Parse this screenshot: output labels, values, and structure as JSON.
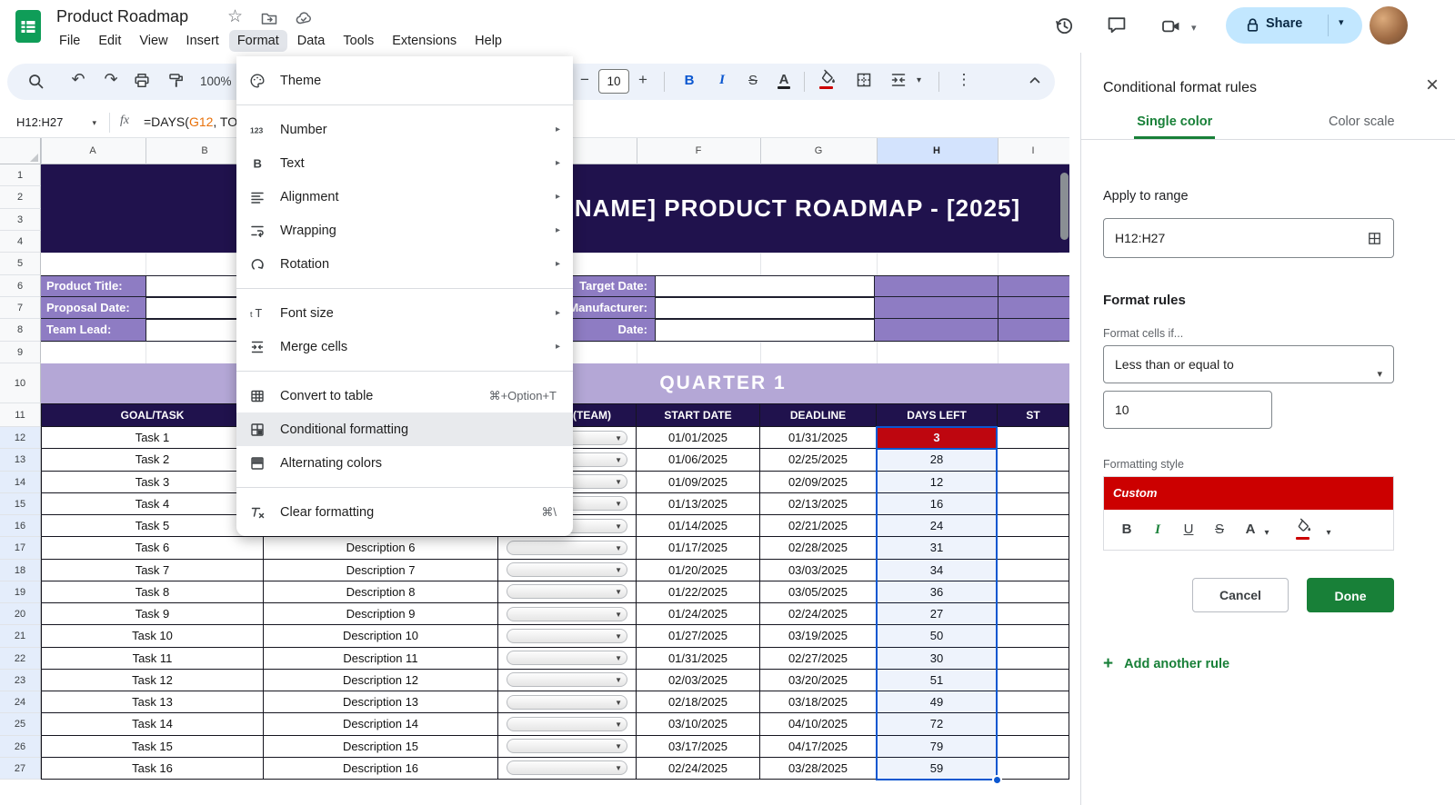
{
  "colors": {
    "accent_green": "#188038",
    "selection_blue": "#0b57d0",
    "rule_red": "#cc0000",
    "banner_purple": "#20124d",
    "info_purple": "#8e7cc3",
    "quarter_purple": "#b4a7d6",
    "share_blue": "#c2e7ff"
  },
  "titlebar": {
    "doc_title": "Product Roadmap",
    "menu_items": [
      "File",
      "Edit",
      "View",
      "Insert",
      "Format",
      "Data",
      "Tools",
      "Extensions",
      "Help"
    ],
    "active_menu": "Format",
    "share_label": "Share",
    "icons": [
      "sheets-logo",
      "star-icon",
      "move-folder-icon",
      "cloud-saved-icon",
      "history-icon",
      "comment-icon",
      "video-call-icon",
      "lock-icon",
      "avatar"
    ]
  },
  "toolbar": {
    "zoom": "100%",
    "font_size": "10",
    "icons": [
      "search-icon",
      "undo-icon",
      "redo-icon",
      "print-icon",
      "paint-format-icon",
      "font-decrease-icon",
      "font-increase-icon",
      "bold-icon",
      "italic-icon",
      "strikethrough-icon",
      "text-color-icon",
      "fill-color-icon",
      "borders-icon",
      "merge-cells-icon",
      "more-icon",
      "collapse-toolbar-icon"
    ]
  },
  "formula_bar": {
    "range": "H12:H27",
    "fx": "fx",
    "formula_prefix": "=DAYS(",
    "formula_ref": "G12",
    "formula_tail": ", TO"
  },
  "format_menu": {
    "items": [
      {
        "label": "Theme",
        "icon": "theme-palette-icon"
      },
      {
        "divider": true
      },
      {
        "label": "Number",
        "icon": "number-123-icon",
        "submenu": true
      },
      {
        "label": "Text",
        "icon": "text-bold-icon",
        "submenu": true
      },
      {
        "label": "Alignment",
        "icon": "alignment-icon",
        "submenu": true
      },
      {
        "label": "Wrapping",
        "icon": "wrapping-icon",
        "submenu": true
      },
      {
        "label": "Rotation",
        "icon": "rotation-icon",
        "submenu": true
      },
      {
        "divider": true
      },
      {
        "label": "Font size",
        "icon": "font-size-icon",
        "submenu": true
      },
      {
        "label": "Merge cells",
        "icon": "merge-cells-icon",
        "submenu": true
      },
      {
        "divider": true
      },
      {
        "label": "Convert to table",
        "icon": "table-icon",
        "shortcut": "⌘+Option+T"
      },
      {
        "label": "Conditional formatting",
        "icon": "conditional-format-icon",
        "highlighted": true
      },
      {
        "label": "Alternating colors",
        "icon": "alternating-colors-icon"
      },
      {
        "divider": true
      },
      {
        "label": "Clear formatting",
        "icon": "clear-format-icon",
        "shortcut": "⌘\\"
      }
    ]
  },
  "sheet": {
    "visible_col_letters": [
      "A",
      "B",
      "F",
      "G",
      "H",
      "I"
    ],
    "selected_col": "H",
    "row_count": 27,
    "selected_rows_start": 12,
    "title_banner": "NAME] PRODUCT ROADMAP - [2025]",
    "quarter_banner": "QUARTER 1",
    "info_rows": [
      {
        "left": "Product Title:",
        "right": "Target Date:"
      },
      {
        "left": "Proposal Date:",
        "right": "Manufacturer:"
      },
      {
        "left": "Team Lead:",
        "right": "Date:"
      }
    ],
    "table_headers": {
      "goal": "GOAL/TASK",
      "team": "(TEAM)",
      "start": "START DATE",
      "deadline": "DEADLINE",
      "days": "DAYS LEFT",
      "status": "ST"
    },
    "rows": [
      {
        "task": "Task 1",
        "desc": "",
        "start": "01/01/2025",
        "deadline": "01/31/2025",
        "days": "3",
        "red": true
      },
      {
        "task": "Task 2",
        "desc": "",
        "start": "01/06/2025",
        "deadline": "02/25/2025",
        "days": "28"
      },
      {
        "task": "Task 3",
        "desc": "",
        "start": "01/09/2025",
        "deadline": "02/09/2025",
        "days": "12"
      },
      {
        "task": "Task 4",
        "desc": "",
        "start": "01/13/2025",
        "deadline": "02/13/2025",
        "days": "16"
      },
      {
        "task": "Task 5",
        "desc": "",
        "start": "01/14/2025",
        "deadline": "02/21/2025",
        "days": "24"
      },
      {
        "task": "Task 6",
        "desc": "Description 6",
        "start": "01/17/2025",
        "deadline": "02/28/2025",
        "days": "31"
      },
      {
        "task": "Task 7",
        "desc": "Description 7",
        "start": "01/20/2025",
        "deadline": "03/03/2025",
        "days": "34"
      },
      {
        "task": "Task 8",
        "desc": "Description 8",
        "start": "01/22/2025",
        "deadline": "03/05/2025",
        "days": "36"
      },
      {
        "task": "Task 9",
        "desc": "Description 9",
        "start": "01/24/2025",
        "deadline": "02/24/2025",
        "days": "27"
      },
      {
        "task": "Task 10",
        "desc": "Description 10",
        "start": "01/27/2025",
        "deadline": "03/19/2025",
        "days": "50"
      },
      {
        "task": "Task 11",
        "desc": "Description 11",
        "start": "01/31/2025",
        "deadline": "02/27/2025",
        "days": "30"
      },
      {
        "task": "Task 12",
        "desc": "Description 12",
        "start": "02/03/2025",
        "deadline": "03/20/2025",
        "days": "51"
      },
      {
        "task": "Task 13",
        "desc": "Description 13",
        "start": "02/18/2025",
        "deadline": "03/18/2025",
        "days": "49"
      },
      {
        "task": "Task 14",
        "desc": "Description 14",
        "start": "03/10/2025",
        "deadline": "04/10/2025",
        "days": "72"
      },
      {
        "task": "Task 15",
        "desc": "Description 15",
        "start": "03/17/2025",
        "deadline": "04/17/2025",
        "days": "79"
      },
      {
        "task": "Task 16",
        "desc": "Description 16",
        "start": "02/24/2025",
        "deadline": "03/28/2025",
        "days": "59"
      }
    ]
  },
  "panel": {
    "title": "Conditional format rules",
    "tabs": [
      "Single color",
      "Color scale"
    ],
    "apply_label": "Apply to range",
    "range_value": "H12:H27",
    "format_rules_label": "Format rules",
    "cells_if_label": "Format cells if...",
    "condition": "Less than or equal to",
    "value": "10",
    "style_label": "Formatting style",
    "preview": "Custom",
    "style_icons": [
      "bold-icon",
      "italic-icon",
      "underline-icon",
      "strikethrough-icon",
      "text-color-icon",
      "fill-color-icon"
    ],
    "cancel": "Cancel",
    "done": "Done",
    "add_rule": "Add another rule"
  }
}
